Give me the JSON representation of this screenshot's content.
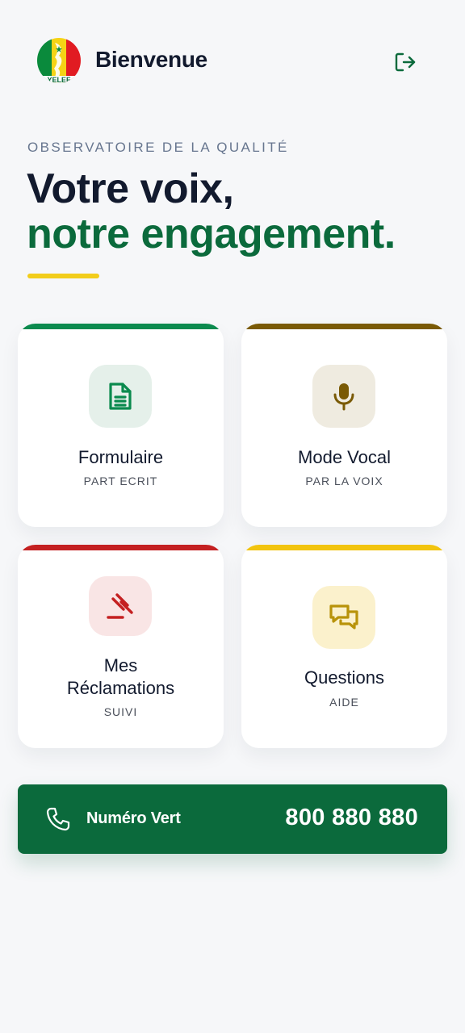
{
  "header": {
    "logo_text": "YELEF",
    "greeting": "Bienvenue",
    "logout_icon": "logout-icon"
  },
  "hero": {
    "eyebrow": "OBSERVATOIRE DE LA QUALITÉ",
    "line1": "Votre voix,",
    "line2": "notre engagement.",
    "accent_color": "#f2cd1b"
  },
  "cards": [
    {
      "title": "Formulaire",
      "subtitle": "PART ECRIT",
      "icon": "document-icon",
      "color": "#0b8a4e",
      "icon_bg": "#e5f0ea"
    },
    {
      "title": "Mode Vocal",
      "subtitle": "PAR LA VOIX",
      "icon": "microphone-icon",
      "color": "#7a5a05",
      "icon_bg": "#efebe0"
    },
    {
      "title": "Mes Réclamations",
      "title_line1": "Mes",
      "title_line2": "Réclamations",
      "subtitle": "SUIVI",
      "icon": "gavel-icon",
      "color": "#c42021",
      "icon_bg": "#f9e5e5"
    },
    {
      "title": "Questions",
      "subtitle": "AIDE",
      "icon": "chat-icon",
      "color": "#f2c40e",
      "icon_bg": "#fbf1cc"
    }
  ],
  "hotline": {
    "label": "Numéro Vert",
    "number": "800 880 880",
    "icon": "phone-icon",
    "color": "#0b6a3c"
  },
  "colors": {
    "brand_green": "#0b6a3c",
    "dark_text": "#121a2e",
    "background": "#f6f7f9"
  }
}
